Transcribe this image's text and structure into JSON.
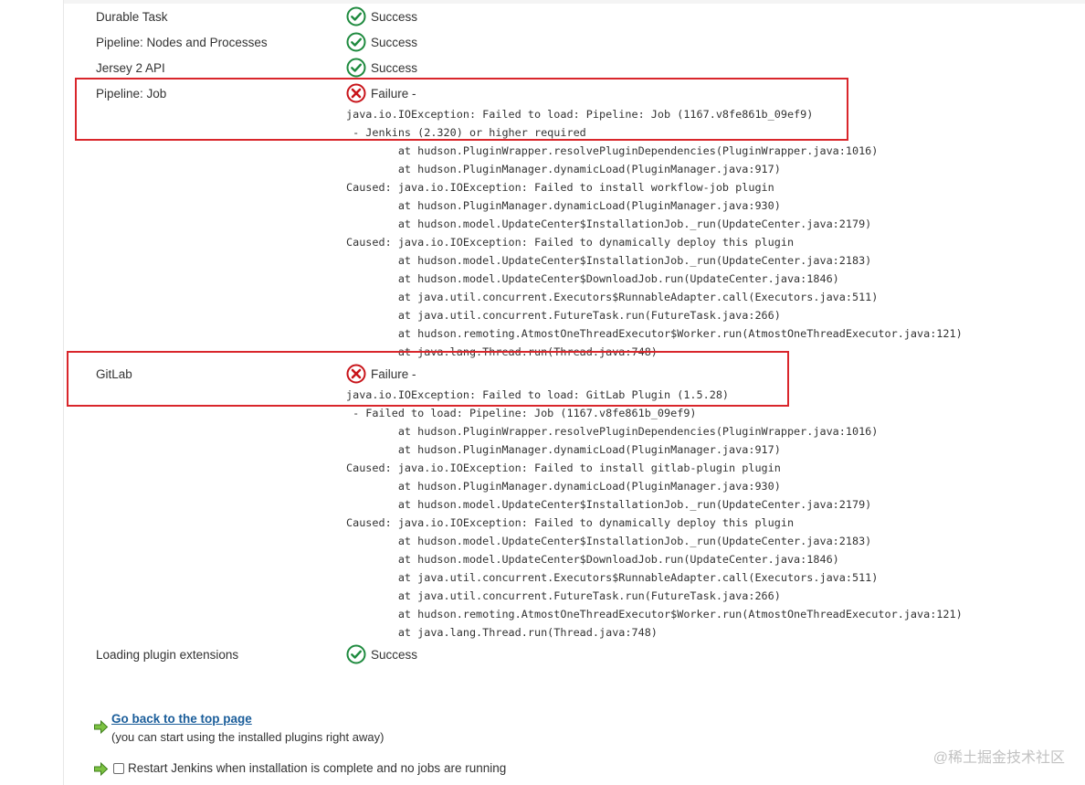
{
  "steps": [
    {
      "name": "Durable Task",
      "status": "Success"
    },
    {
      "name": "Pipeline: Nodes and Processes",
      "status": "Success"
    },
    {
      "name": "Jersey 2 API",
      "status": "Success"
    },
    {
      "name": "Pipeline: Job",
      "status": "Failure -",
      "trace": "java.io.IOException: Failed to load: Pipeline: Job (1167.v8fe861b_09ef9)\n - Jenkins (2.320) or higher required\n        at hudson.PluginWrapper.resolvePluginDependencies(PluginWrapper.java:1016)\n        at hudson.PluginManager.dynamicLoad(PluginManager.java:917)\nCaused: java.io.IOException: Failed to install workflow-job plugin\n        at hudson.PluginManager.dynamicLoad(PluginManager.java:930)\n        at hudson.model.UpdateCenter$InstallationJob._run(UpdateCenter.java:2179)\nCaused: java.io.IOException: Failed to dynamically deploy this plugin\n        at hudson.model.UpdateCenter$InstallationJob._run(UpdateCenter.java:2183)\n        at hudson.model.UpdateCenter$DownloadJob.run(UpdateCenter.java:1846)\n        at java.util.concurrent.Executors$RunnableAdapter.call(Executors.java:511)\n        at java.util.concurrent.FutureTask.run(FutureTask.java:266)\n        at hudson.remoting.AtmostOneThreadExecutor$Worker.run(AtmostOneThreadExecutor.java:121)\n        at java.lang.Thread.run(Thread.java:748)"
    },
    {
      "name": "GitLab",
      "status": "Failure -",
      "trace": "java.io.IOException: Failed to load: GitLab Plugin (1.5.28)\n - Failed to load: Pipeline: Job (1167.v8fe861b_09ef9)\n        at hudson.PluginWrapper.resolvePluginDependencies(PluginWrapper.java:1016)\n        at hudson.PluginManager.dynamicLoad(PluginManager.java:917)\nCaused: java.io.IOException: Failed to install gitlab-plugin plugin\n        at hudson.PluginManager.dynamicLoad(PluginManager.java:930)\n        at hudson.model.UpdateCenter$InstallationJob._run(UpdateCenter.java:2179)\nCaused: java.io.IOException: Failed to dynamically deploy this plugin\n        at hudson.model.UpdateCenter$InstallationJob._run(UpdateCenter.java:2183)\n        at hudson.model.UpdateCenter$DownloadJob.run(UpdateCenter.java:1846)\n        at java.util.concurrent.Executors$RunnableAdapter.call(Executors.java:511)\n        at java.util.concurrent.FutureTask.run(FutureTask.java:266)\n        at hudson.remoting.AtmostOneThreadExecutor$Worker.run(AtmostOneThreadExecutor.java:121)\n        at java.lang.Thread.run(Thread.java:748)"
    },
    {
      "name": "Loading plugin extensions",
      "status": "Success"
    }
  ],
  "icons": {
    "success": "check-circle-icon",
    "failure": "x-circle-icon",
    "arrow": "green-arrow-icon"
  },
  "colors": {
    "success": "#1e8a3e",
    "failure": "#c8141a",
    "highlight": "#d9262b",
    "link": "#1a5d9a"
  },
  "footer": {
    "back_link": "Go back to the top page",
    "back_note": "(you can start using the installed plugins right away)",
    "restart_label": "Restart Jenkins when installation is complete and no jobs are running",
    "restart_checked": false
  },
  "watermark": "@稀土掘金技术社区"
}
